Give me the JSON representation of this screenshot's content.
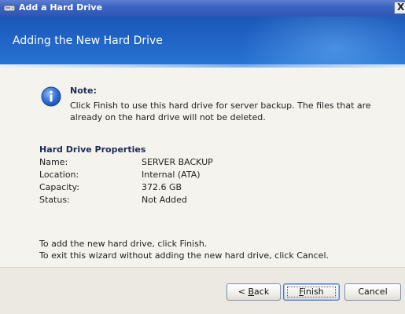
{
  "window": {
    "title": "Add a Hard Drive",
    "close_glyph": "X"
  },
  "header": {
    "title": "Adding the New Hard Drive"
  },
  "note": {
    "title": "Note:",
    "lines": [
      "Click Finish to use this hard drive for server backup. The files that are",
      "already on the hard drive will not be deleted."
    ],
    "icon": "info-icon"
  },
  "properties": {
    "title": "Hard Drive Properties",
    "rows": [
      {
        "label": "Name:",
        "value": "SERVER BACKUP"
      },
      {
        "label": "Location:",
        "value": "Internal (ATA)"
      },
      {
        "label": "Capacity:",
        "value": "372.6 GB"
      },
      {
        "label": "Status:",
        "value": "Not Added"
      }
    ]
  },
  "instructions": [
    "To add the new hard drive, click Finish.",
    "To exit this wizard without adding the new hard drive, click Cancel."
  ],
  "buttons": {
    "back_prefix": "< ",
    "back_key": "B",
    "back_rest": "ack",
    "finish_key": "F",
    "finish_rest": "inish",
    "cancel": "Cancel"
  },
  "colors": {
    "titlebar": "#3a62c0",
    "banner": "#1f62c4",
    "content_bg": "#f4f3ee",
    "button_bar_bg": "#ebe9e2"
  }
}
